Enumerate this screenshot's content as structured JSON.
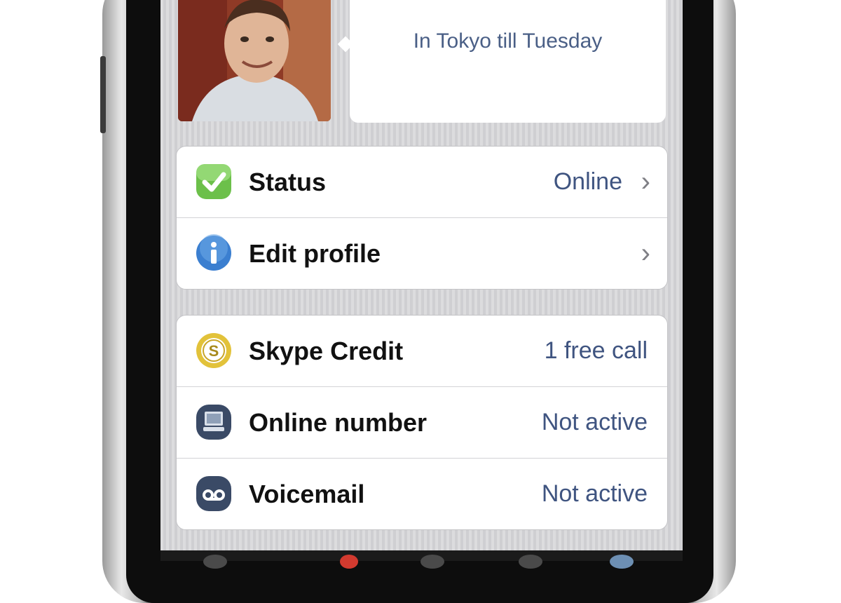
{
  "profile": {
    "mood_message": "In Tokyo till Tuesday"
  },
  "groups": [
    {
      "rows": [
        {
          "icon": "status-check-icon",
          "label": "Status",
          "value": "Online",
          "chevron": "›"
        },
        {
          "icon": "info-icon",
          "label": "Edit profile",
          "value": "",
          "chevron": "›"
        }
      ]
    },
    {
      "rows": [
        {
          "icon": "skype-credit-coin-icon",
          "label": "Skype Credit",
          "value": "1 free call"
        },
        {
          "icon": "online-number-phone-icon",
          "label": "Online number",
          "value": "Not active"
        },
        {
          "icon": "voicemail-icon",
          "label": "Voicemail",
          "value": "Not active"
        }
      ]
    }
  ],
  "colors": {
    "value_text": "#3f5480",
    "status_green": "#6cc04a",
    "info_blue": "#3b7fd0",
    "credit_gold": "#e2c23a",
    "dark_icon": "#3a4a66"
  }
}
